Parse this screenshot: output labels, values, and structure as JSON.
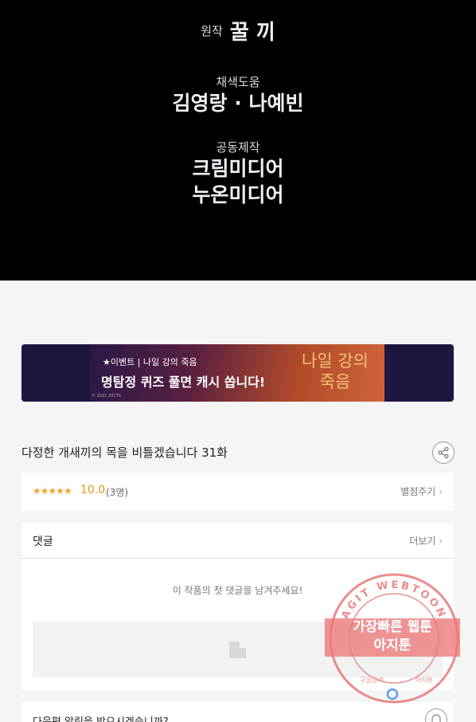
{
  "credits": {
    "original_label": "원작",
    "original_name": "꿀 끼",
    "coloring_label": "채색도움",
    "coloring_names": "김영랑 · 나예빈",
    "production_label": "공동제작",
    "production_company_1": "크림미디어",
    "production_company_2": "누온미디어"
  },
  "banner": {
    "small_text": "★이벤트 | 나일 강의 죽음",
    "big_text": "명탐정 퀴즈 풀면 캐시 쏩니다!",
    "copyright": "© 2021 20CTS",
    "logo_line1": "나일 강의",
    "logo_line2": "죽음"
  },
  "episode": {
    "title": "다정한 개새끼의 목을 비틀겠습니다 31화"
  },
  "rating": {
    "stars": "★★★★★",
    "score": "10.0",
    "count": "(3명)",
    "give_label": "별점주기"
  },
  "comments": {
    "title": "댓글",
    "more_label": "더보기",
    "empty_text": "이 작품의 첫 댓글을 남겨주세요!"
  },
  "notify": {
    "question": "다음편 알림을 받으시겠습니까?"
  },
  "watermark": {
    "arc_text": "AGIT WEBTOON",
    "line1": "가장빠른 웹툰",
    "line2": "아지툰",
    "bottom_left": "구글검색",
    "bottom_right": "아지툰"
  },
  "colors": {
    "credits_bg": "#000000",
    "page_bg": "#f5f5f5",
    "rating_accent": "#e8940f",
    "stamp": "#e87878"
  },
  "icons": [
    "share-icon",
    "chevron-right-icon",
    "bell-icon",
    "image-placeholder-icon"
  ]
}
